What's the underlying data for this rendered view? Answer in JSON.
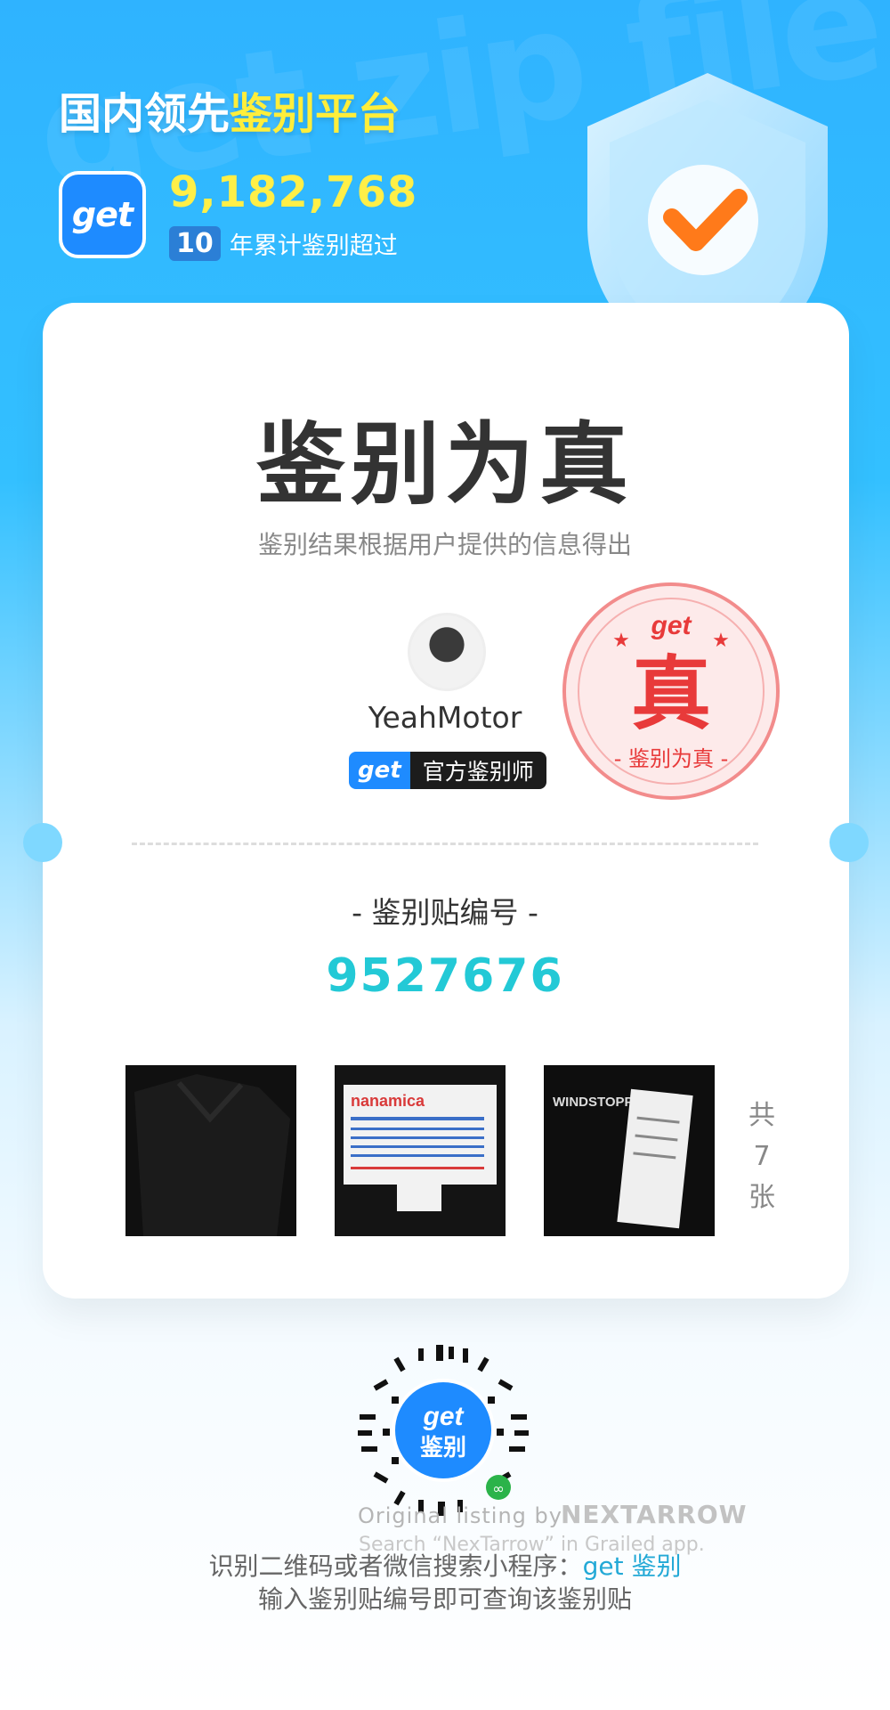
{
  "header": {
    "headline_part1": "国内领先",
    "headline_part2": "鉴别平台",
    "logo_text": "get",
    "total_count": "9,182,768",
    "years_badge": "10",
    "years_text": "年累计鉴别超过"
  },
  "card": {
    "result_title": "鉴别为真",
    "result_subtitle": "鉴别结果根据用户提供的信息得出",
    "appraiser": {
      "username": "YeahMotor",
      "badge_brand": "get",
      "badge_label": "官方鉴别师"
    },
    "stamp": {
      "brand": "get",
      "main_char": "真",
      "ring_text": "- 鉴别为真 -"
    },
    "serial_label": "- 鉴别贴编号 -",
    "serial_number": "9527676",
    "photos": [
      {
        "caption": ""
      },
      {
        "caption": "nanamica"
      },
      {
        "caption": "WINDSTOPPER"
      }
    ],
    "photo_total_1": "共",
    "photo_total_2": "7",
    "photo_total_3": "张"
  },
  "footer": {
    "qr_label_1": "get",
    "qr_label_2": "鉴别",
    "watermark_line1": "Original listing by",
    "watermark_brand": "NEXTARROW",
    "watermark_line2": "Search “NexTarrow” in Grailed app.",
    "instruction_1": "识别二维码或者微信搜索小程序：",
    "instruction_1_accent": "get 鉴别",
    "instruction_2": "输入鉴别贴编号即可查询该鉴别贴"
  },
  "colors": {
    "accent_cyan": "#23c9d6",
    "brand_blue": "#1e8bff",
    "headline_yellow": "#ffee3b",
    "stamp_red": "#e83a3a"
  }
}
